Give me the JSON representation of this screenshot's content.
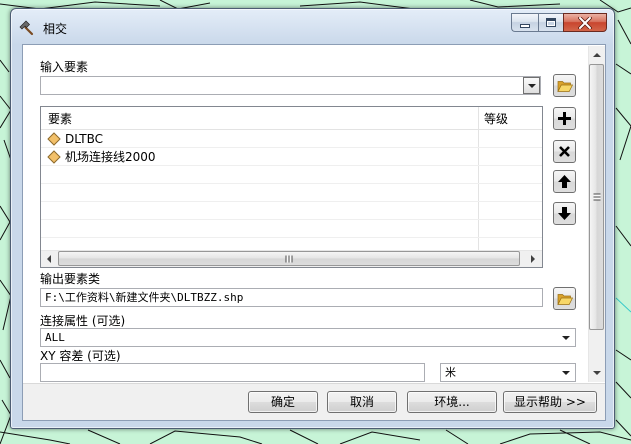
{
  "window": {
    "title": "相交",
    "title_icon": "hammer-icon",
    "controls": {
      "minimize": "minimize-icon",
      "maximize": "maximize-icon",
      "close": "close-icon"
    }
  },
  "input_features": {
    "label": "输入要素",
    "value": "",
    "browse_icon": "folder-open-icon",
    "table": {
      "columns": [
        "要素",
        "等级"
      ],
      "rows": [
        {
          "feature": "DLTBC",
          "rank": "",
          "icon": "polygon-feature-icon"
        },
        {
          "feature": "机场连接线2000",
          "rank": "",
          "icon": "polygon-feature-icon"
        }
      ]
    },
    "row_actions": [
      "add-icon",
      "remove-icon",
      "move-up-icon",
      "move-down-icon"
    ]
  },
  "output_feature_class": {
    "label": "输出要素类",
    "value": "F:\\工作资料\\新建文件夹\\DLTBZZ.shp",
    "browse_icon": "folder-open-icon"
  },
  "join_attributes": {
    "label": "连接属性 (可选)",
    "selected": "ALL"
  },
  "xy_tolerance": {
    "label": "XY 容差 (可选)",
    "value": "",
    "unit": "米"
  },
  "buttons": {
    "ok": "确定",
    "cancel": "取消",
    "environments": "环境...",
    "show_help": "显示帮助 >>"
  },
  "colors": {
    "map_background": "#c7f4d7",
    "window_frame": "#c9d8ea",
    "close_button": "#c9452e",
    "panel_background": "#ffffff",
    "button_bar": "#f0f0f0",
    "feature_icon": "#f2c069"
  }
}
